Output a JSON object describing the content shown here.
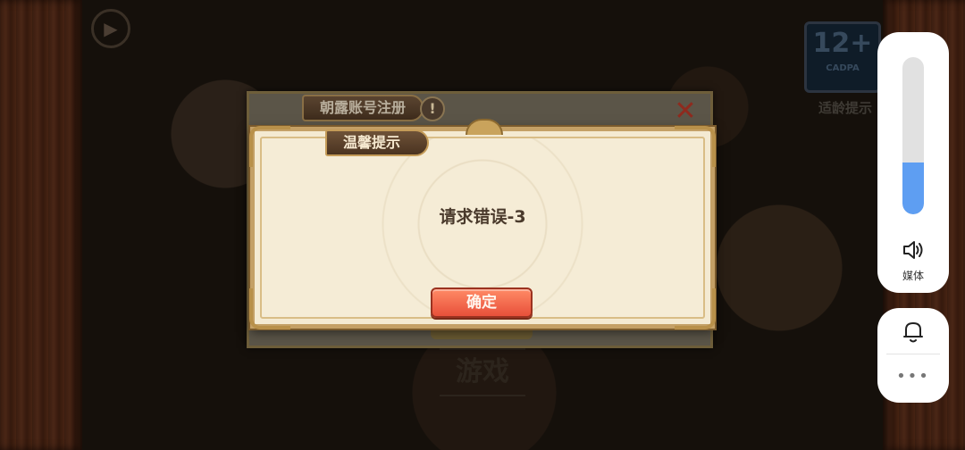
{
  "background": {
    "game_label": "游戏",
    "age_rating": {
      "number": "12+",
      "sub": "CADPA",
      "caption": "适龄提示"
    }
  },
  "register_panel": {
    "title": "朝露账号注册",
    "warning_icon": "!",
    "close_icon": "✕"
  },
  "dialog": {
    "title": "温馨提示",
    "message": "请求错误-3",
    "confirm_label": "确定"
  },
  "system_overlay": {
    "volume_label": "媒体",
    "volume_level": 0.33,
    "volume_color": "#5e9ef2",
    "more_glyph": "•••"
  },
  "colors": {
    "dialog_bg": "#f4ead2",
    "dialog_border": "#c4a066",
    "confirm_button": "#e8503a",
    "close_red": "#8f2a1e"
  }
}
